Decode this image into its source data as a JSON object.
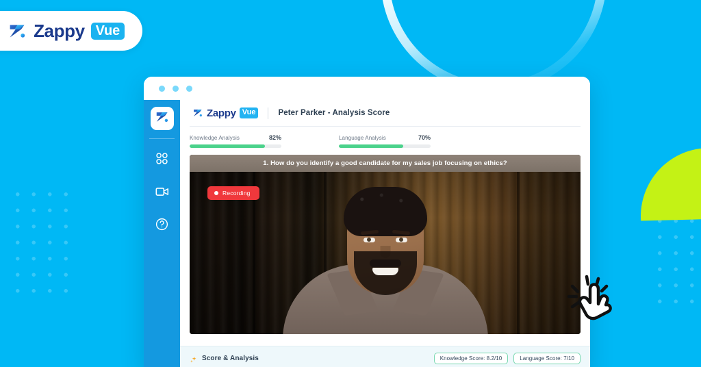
{
  "brand": {
    "name": "Zappy",
    "badge": "Vue",
    "mark_icon": "zappy-z-mark-icon"
  },
  "background": {
    "page_color": "#00b8f5",
    "lime_color": "#c4f215",
    "dot_pattern_color": "rgba(255,255,255,0.22)",
    "arc_color": "#ffffff"
  },
  "browser": {
    "dots": [
      "dot-1",
      "dot-2",
      "dot-3"
    ]
  },
  "sidebar": {
    "logo_icon": "zappy-z-mark-icon",
    "items": [
      {
        "icon": "grid-squares-icon",
        "name": "dashboard"
      },
      {
        "icon": "video-camera-icon",
        "name": "interviews"
      },
      {
        "icon": "question-circle-icon",
        "name": "help"
      }
    ]
  },
  "app_header": {
    "brand_name": "Zappy",
    "brand_badge": "Vue",
    "title": "Peter Parker - Analysis Score"
  },
  "analysis": {
    "accent_color": "#4bd28b",
    "items": [
      {
        "label": "Knowledge Analysis",
        "value": "82%",
        "percent": 82
      },
      {
        "label": "Language Analysis",
        "value": "70%",
        "percent": 70
      }
    ]
  },
  "video": {
    "question": "1. How do you identify a good candidate for my sales job focusing on ethics?",
    "recording_label": "Recording",
    "recording_color": "#f0383c",
    "recording_dot_icon": "record-dot-icon"
  },
  "cursor": {
    "icon": "pointing-hand-click-cursor-icon"
  },
  "score_panel": {
    "sparkle_icon": "sparkle-icon",
    "title": "Score & Analysis",
    "chips": [
      {
        "label": "Knowledge Score: 8.2/10"
      },
      {
        "label": "Language Score: 7/10"
      }
    ],
    "chip_border_color": "#79d8b0",
    "panel_color": "#eef8fb"
  }
}
